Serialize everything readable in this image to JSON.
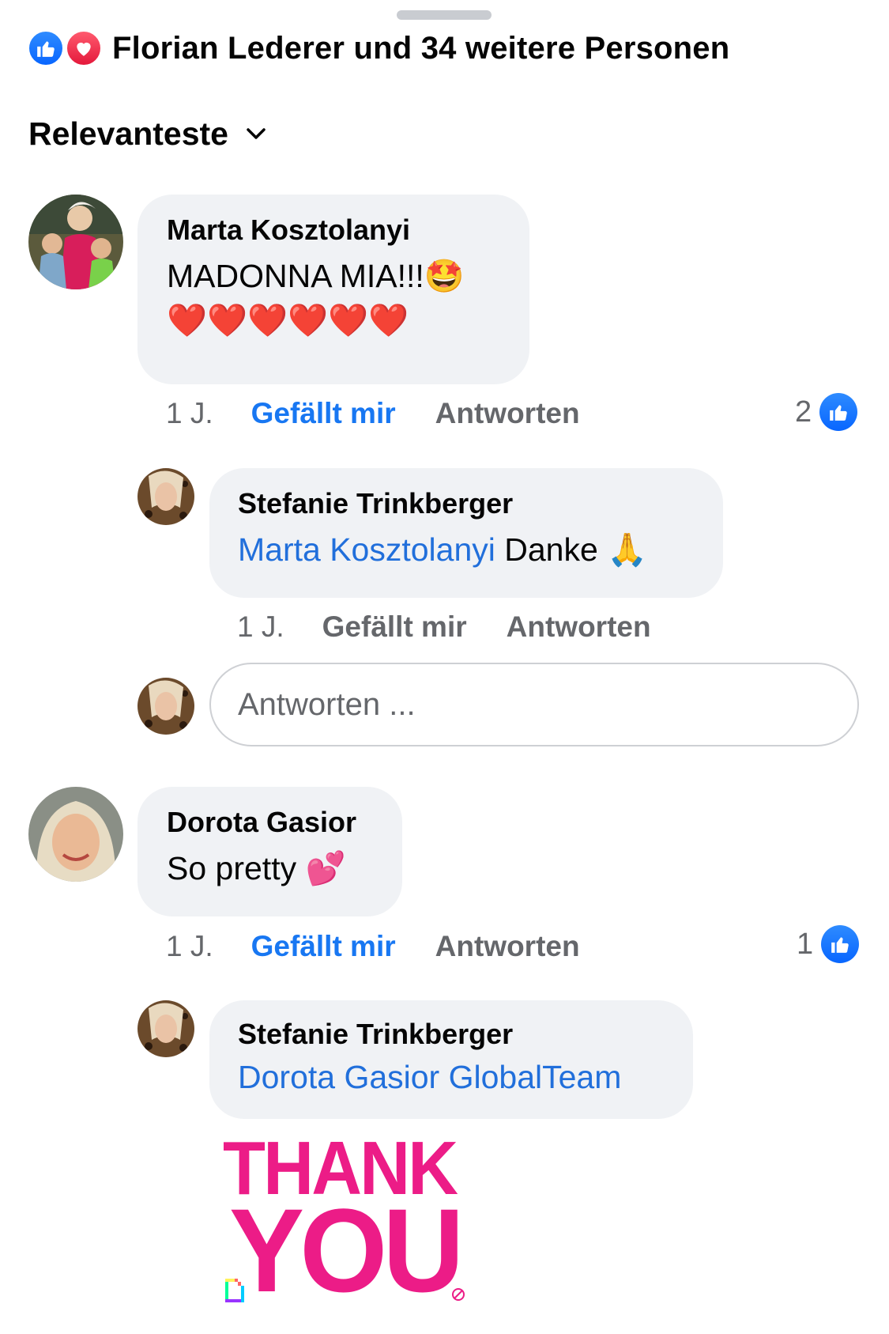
{
  "header": {
    "reactions_summary": "Florian Lederer und 34 weitere Personen",
    "reaction_icons": [
      "like-icon",
      "love-icon"
    ]
  },
  "sort": {
    "label": "Relevanteste",
    "icon": "chevron-down-icon"
  },
  "comments": [
    {
      "author": "Marta Kosztolanyi",
      "text": "MADONNA MIA!!!🤩",
      "text_line2": "❤️❤️❤️❤️❤️❤️",
      "time": "1 J.",
      "like_label": "Gefällt mir",
      "reply_label": "Antworten",
      "reaction_count": "2",
      "reply": {
        "author": "Stefanie Trinkberger",
        "mention": "Marta Kosztolanyi",
        "text": " Danke 🙏",
        "time": "1 J.",
        "like_label": "Gefällt mir",
        "reply_label": "Antworten"
      }
    },
    {
      "author": "Dorota Gasior",
      "text": "So pretty 💕",
      "time": "1 J.",
      "like_label": "Gefällt mir",
      "reply_label": "Antworten",
      "reaction_count": "1",
      "reply": {
        "author": "Stefanie Trinkberger",
        "mention": "Dorota Gasior GlobalTeam",
        "sticker_line1": "THANK",
        "sticker_line2": "YOU"
      }
    }
  ],
  "reply_input": {
    "placeholder": "Antworten ..."
  },
  "colors": {
    "link_blue": "#1877f2",
    "mention_blue": "#216fdb",
    "bubble_bg": "#f0f2f5",
    "meta_gray": "#65676b",
    "sticker_pink": "#ec1c87"
  }
}
